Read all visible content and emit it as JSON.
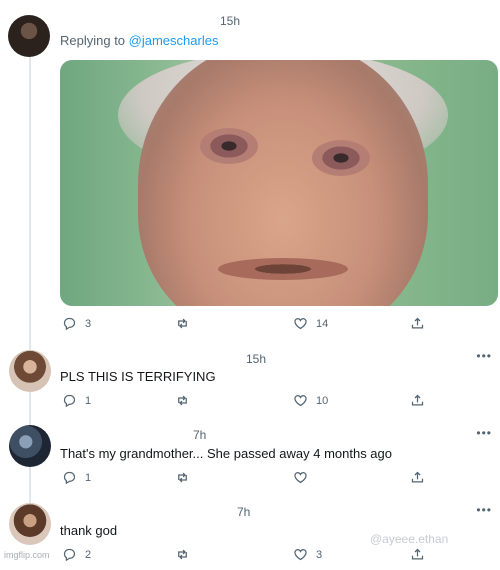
{
  "thread": [
    {
      "time": "15h",
      "reply_prefix": "Replying to ",
      "reply_handle": "@jamescharles",
      "text": "",
      "actions": {
        "replies": "3",
        "retweets": "",
        "likes": "14"
      }
    },
    {
      "time": "15h",
      "text": "PLS THIS IS TERRIFYING",
      "actions": {
        "replies": "1",
        "retweets": "",
        "likes": "10"
      }
    },
    {
      "time": "7h",
      "text": "That's my grandmother... She passed away 4 months ago",
      "actions": {
        "replies": "1",
        "retweets": "",
        "likes": ""
      }
    },
    {
      "time": "7h",
      "text": "thank god",
      "actions": {
        "replies": "2",
        "retweets": "",
        "likes": "3"
      }
    }
  ],
  "more_label": "•••",
  "watermark": "@ayeee.ethan",
  "imgflip_label": "imgflip.com",
  "colors": {
    "link": "#1d9bf0",
    "muted": "#536471",
    "text": "#14171a"
  },
  "icons": {
    "reply": "reply-icon",
    "retweet": "retweet-icon",
    "like": "heart-icon",
    "share": "share-icon",
    "more": "more-icon"
  }
}
